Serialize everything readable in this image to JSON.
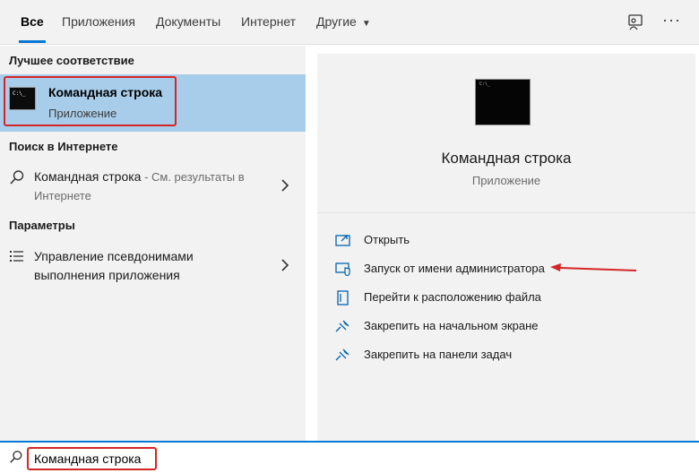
{
  "tabs": [
    {
      "label": "Все"
    },
    {
      "label": "Приложения"
    },
    {
      "label": "Документы"
    },
    {
      "label": "Интернет"
    },
    {
      "label": "Другие"
    }
  ],
  "sections": {
    "best_match": "Лучшее соответствие",
    "web_search": "Поиск в Интернете",
    "settings": "Параметры"
  },
  "best_match": {
    "title": "Командная строка",
    "subtitle": "Приложение",
    "icon_text": "C:\\_"
  },
  "web_result": {
    "query": "Командная строка",
    "suffix": " - См. результаты в Интернете"
  },
  "settings_result": {
    "label": "Управление псевдонимами выполнения приложения"
  },
  "preview": {
    "title": "Командная строка",
    "subtitle": "Приложение"
  },
  "actions": [
    {
      "label": "Открыть",
      "icon": "open-icon"
    },
    {
      "label": "Запуск от имени администратора",
      "icon": "admin-shield-icon"
    },
    {
      "label": "Перейти к расположению файла",
      "icon": "file-location-icon"
    },
    {
      "label": "Закрепить на начальном экране",
      "icon": "pin-icon"
    },
    {
      "label": "Закрепить на панели задач",
      "icon": "pin-icon"
    }
  ],
  "search": {
    "value": "Командная строка"
  },
  "colors": {
    "accent": "#0078d7",
    "highlight": "#a8cdea",
    "annotation_red": "#d42525"
  }
}
